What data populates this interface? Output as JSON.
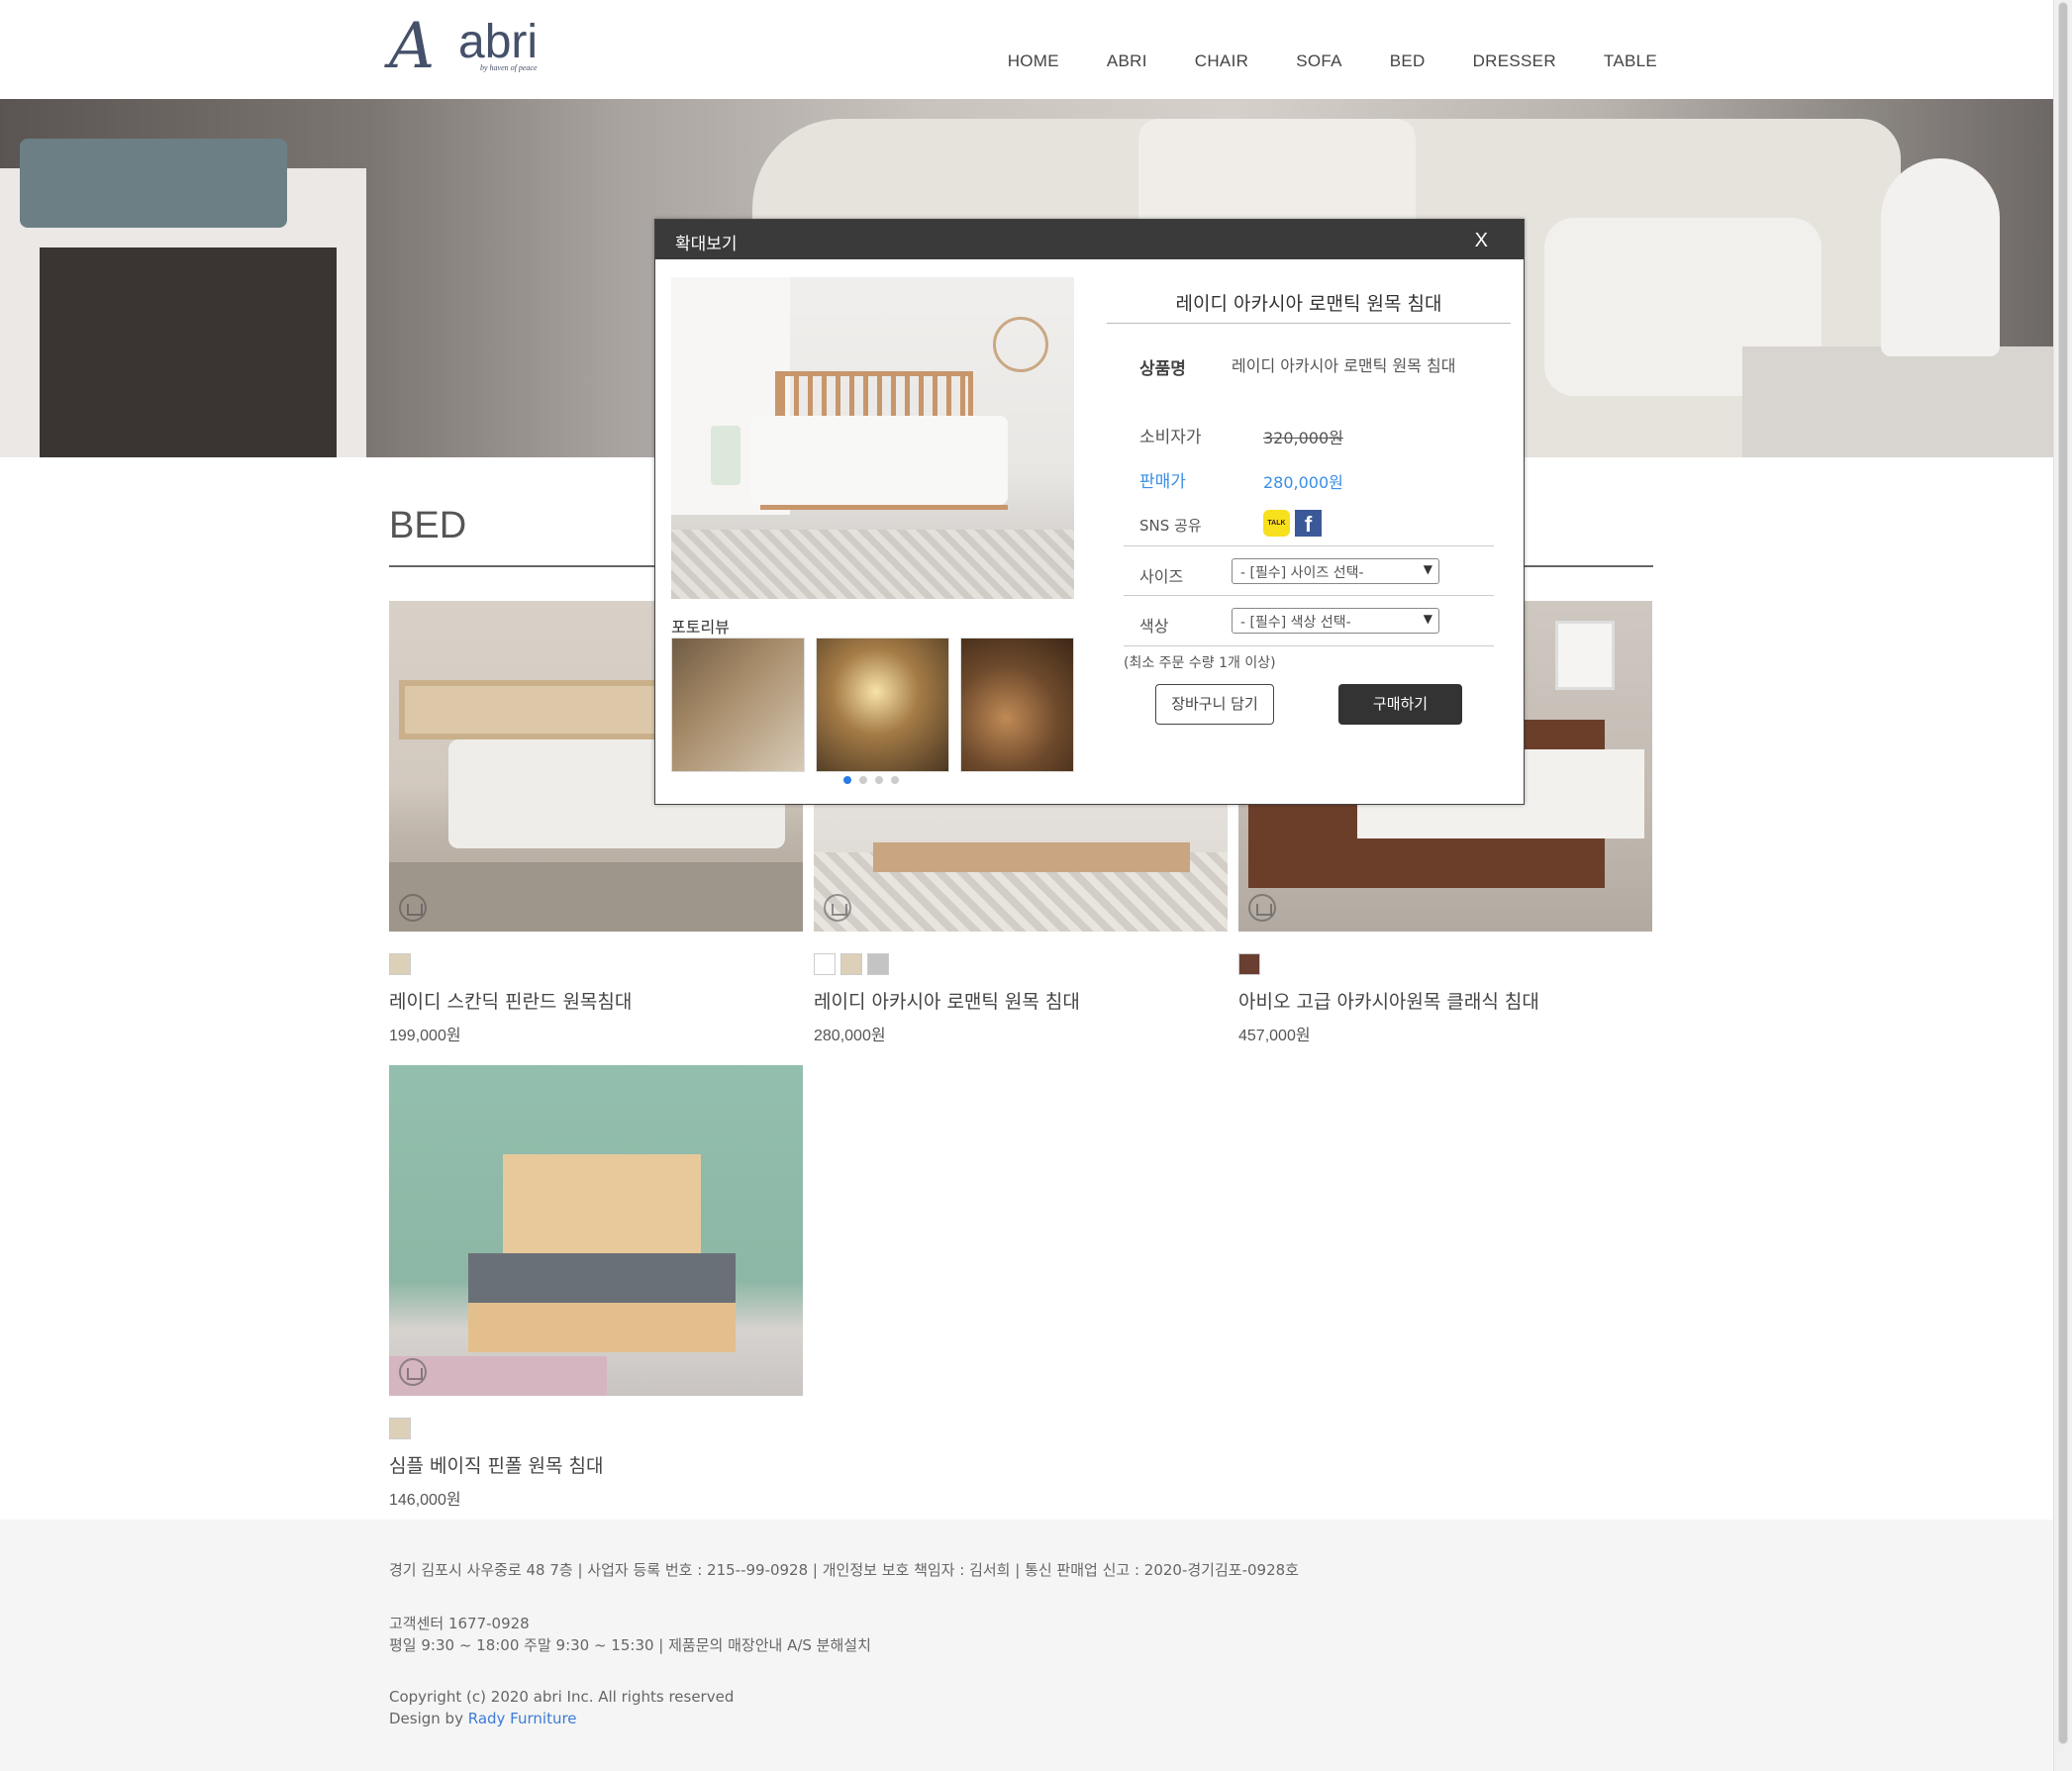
{
  "header": {
    "logo_letter": "A",
    "logo_text": "abri",
    "logo_tagline": "by haven of peace",
    "nav": [
      "HOME",
      "ABRI",
      "CHAIR",
      "SOFA",
      "BED",
      "DRESSER",
      "TABLE"
    ]
  },
  "section": {
    "title": "BED"
  },
  "products": [
    {
      "name": "레이디 스칸딕 핀란드 원목침대",
      "price": "199,000원",
      "swatches": [
        "#dcd0b8"
      ]
    },
    {
      "name": "레이디 아카시아 로맨틱 원목 침대",
      "price": "280,000원",
      "swatches": [
        "#ffffff",
        "#dcd0b8",
        "#c4c4c4"
      ]
    },
    {
      "name": "아비오 고급 아카시아원목 클래식 침대",
      "price": "457,000원",
      "swatches": [
        "#6b3e32"
      ]
    },
    {
      "name": "심플 베이직 핀폴 원목 침대",
      "price": "146,000원",
      "swatches": [
        "#dcd0b8"
      ]
    }
  ],
  "footer": {
    "line1": "경기 김포시 사우중로 48 7층 | 사업자 등록 번호 : 215--99-0928 | 개인정보 보호 책임자 : 김서희 | 통신 판매업 신고 : 2020-경기김포-0928호",
    "line2": "고객센터 1677-0928",
    "line3": "평일 9:30 ~ 18:00 주말 9:30 ~ 15:30 | 제품문의 매장안내 A/S 분해설치",
    "copyright": "Copyright (c) 2020 abri Inc. All rights reserved",
    "design_prefix": "Design by ",
    "design_brand": "Rady Furniture"
  },
  "modal": {
    "title": "확대보기",
    "close_label": "X",
    "review_label": "포토리뷰",
    "product_title": "레이디 아카시아 로맨틱 원목 침대",
    "name_label": "상품명",
    "name_value": "레이디 아카시아 로맨틱 원목 침대",
    "consumer_price_label": "소비자가",
    "consumer_price": "320,000원",
    "sale_price_label": "판매가",
    "sale_price": "280,000원",
    "sns_label": "SNS 공유",
    "kakao_text": "TALK",
    "facebook_text": "f",
    "size_label": "사이즈",
    "size_select": "- [필수] 사이즈 선택-",
    "color_label": "색상",
    "color_select": "- [필수] 색상 선택-",
    "min_order": "(최소 주문 수량 1개 이상)",
    "cart_button": "장바구니 담기",
    "buy_button": "구매하기",
    "carousel_pages": 4,
    "carousel_active": 1
  },
  "colors": {
    "accent_blue": "#3a8ee6",
    "dark": "#333333",
    "kakao": "#f7e01c",
    "facebook": "#3b5998"
  }
}
